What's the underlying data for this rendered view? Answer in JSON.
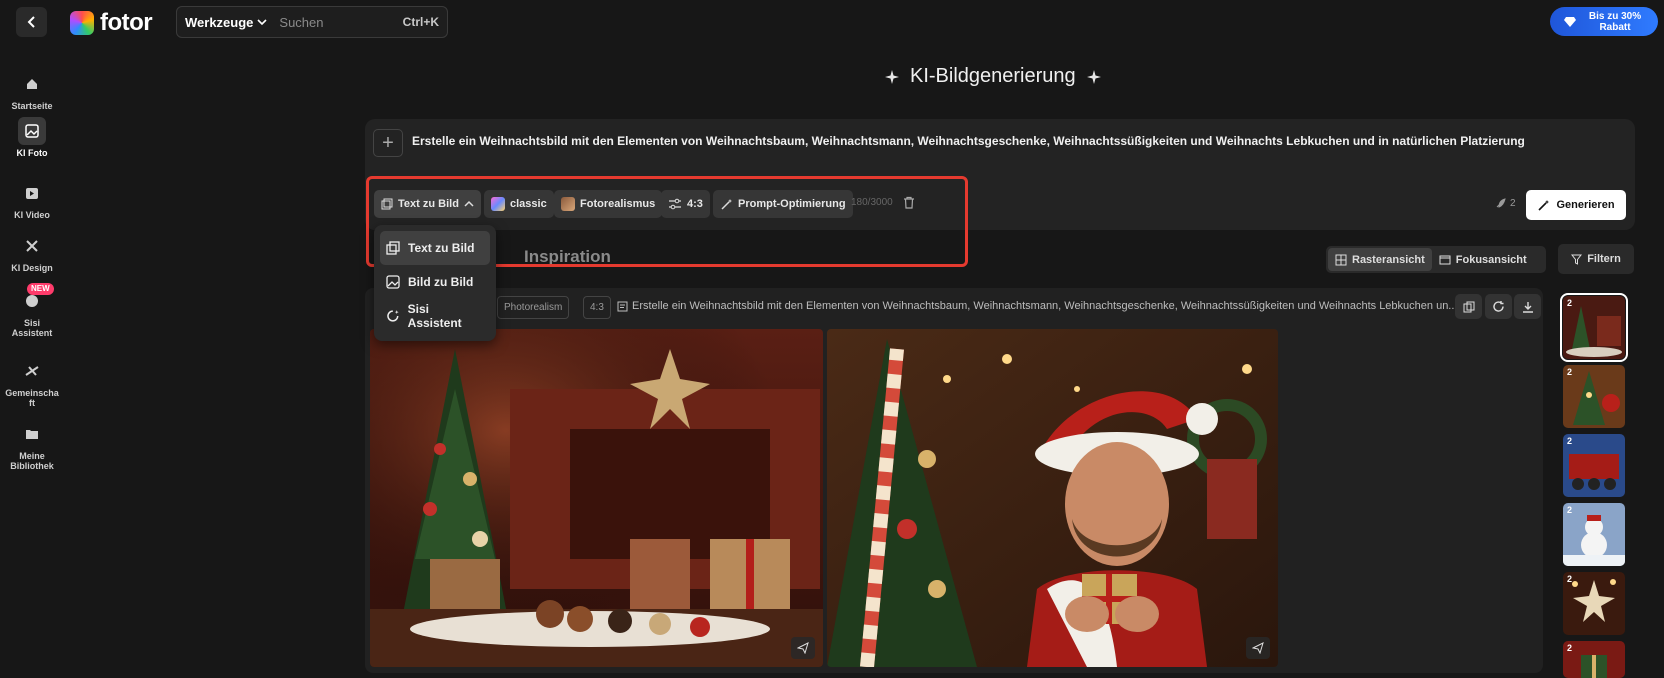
{
  "header": {
    "logo_text": "fotor",
    "tools_label": "Werkzeuge",
    "search_placeholder": "Suchen",
    "shortcut": "Ctrl+K",
    "promo_text": "Bis zu 30% Rabatt"
  },
  "sidebar": {
    "items": [
      {
        "label": "Startseite",
        "icon": "home-icon"
      },
      {
        "label": "KI Foto",
        "icon": "ai-photo-icon"
      },
      {
        "label": "KI Video",
        "icon": "ai-video-icon"
      },
      {
        "label": "KI Design",
        "icon": "ai-design-icon"
      },
      {
        "label": "Sisi Assistent",
        "icon": "sisi-icon",
        "badge": "NEW"
      },
      {
        "label": "Gemeinschaft",
        "icon": "community-icon"
      },
      {
        "label": "Meine Bibliothek",
        "icon": "folder-icon"
      }
    ]
  },
  "page": {
    "title": "KI-Bildgenerierung"
  },
  "prompt": {
    "text": "Erstelle ein Weihnachtsbild mit den Elementen von Weihnachtsbaum, Weihnachtsmann, Weihnachtsgeschenke, Weihnachtssüßigkeiten und Weihnachts Lebkuchen und in natürlichen Platzierung",
    "mode_label": "Text zu Bild",
    "model_label": "classic",
    "style_label": "Fotorealismus",
    "ratio_label": "4:3",
    "optimize_label": "Prompt-Optimierung",
    "counter": "180/3000",
    "credits": "2",
    "generate_label": "Generieren"
  },
  "dropdown": {
    "items": [
      "Text zu Bild",
      "Bild zu Bild",
      "Sisi Assistent"
    ],
    "selected": "Text zu Bild"
  },
  "tabs": {
    "inspiration_label": "Inspiration"
  },
  "views": {
    "grid_label": "Rasteransicht",
    "focus_label": "Fokusansicht",
    "filter_label": "Filtern"
  },
  "result": {
    "style_tag": "Photorealism",
    "ratio_tag": "4:3",
    "prompt": "Erstelle ein Weihnachtsbild mit den Elementen von Weihnachtsbaum, Weihnachtsmann, Weihnachtsgeschenke, Weihnachtssüßigkeiten und Weihnachts Lebkuchen un..."
  },
  "thumbnails": [
    {
      "count": "2"
    },
    {
      "count": "2"
    },
    {
      "count": "2"
    },
    {
      "count": "2"
    },
    {
      "count": "2"
    },
    {
      "count": "2"
    }
  ],
  "colors": {
    "accent_blue": "#2f7bff",
    "highlight_red": "#e53a2f",
    "badge_pink": "#ff3b6b"
  }
}
